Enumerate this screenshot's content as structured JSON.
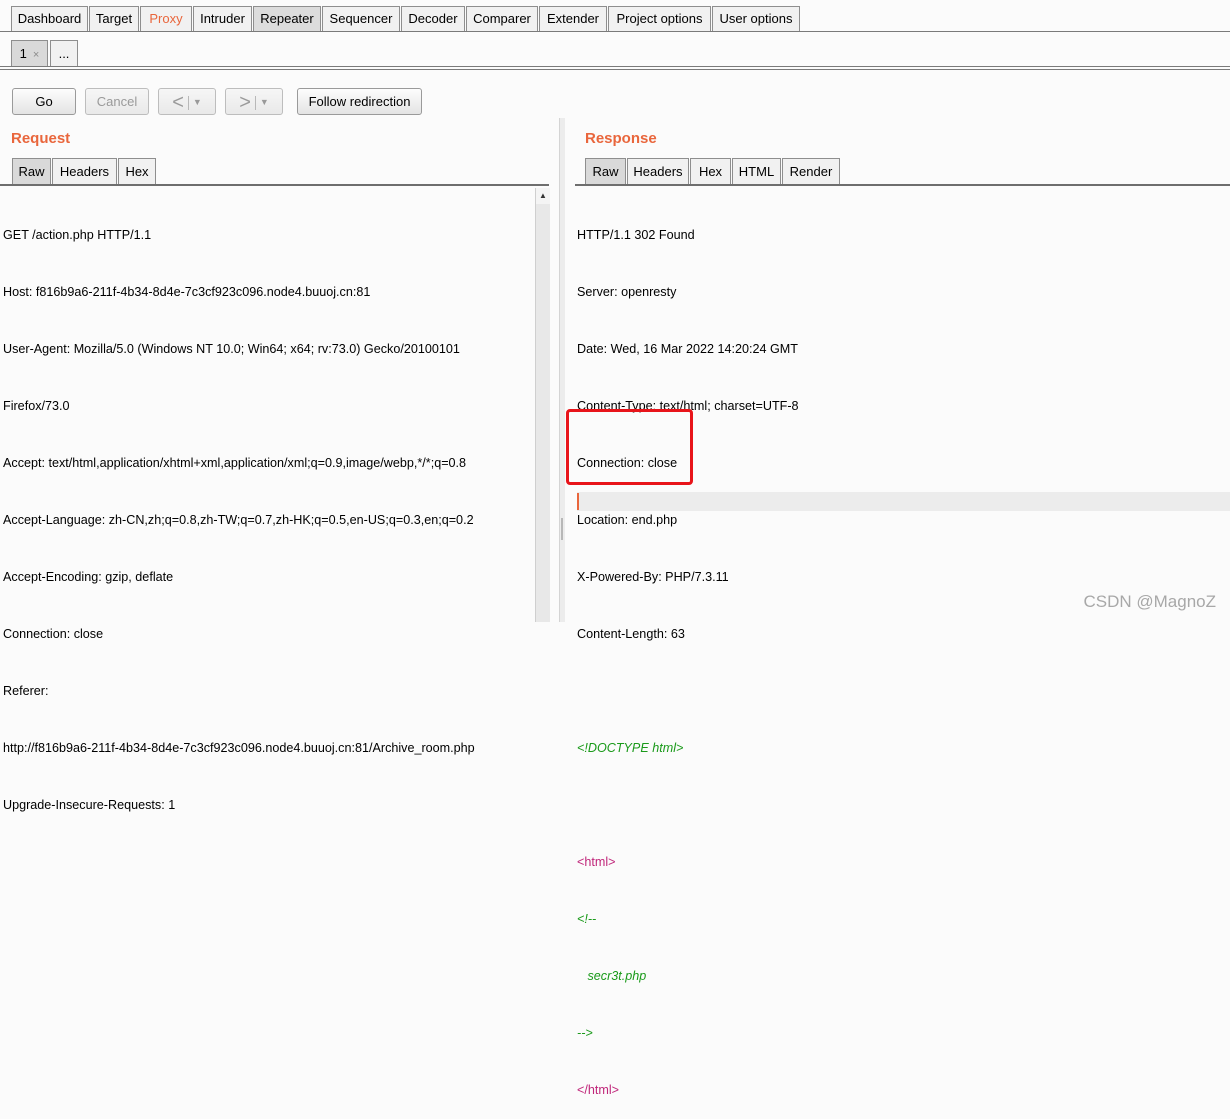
{
  "main_tabs": [
    "Dashboard",
    "Target",
    "Proxy",
    "Intruder",
    "Repeater",
    "Sequencer",
    "Decoder",
    "Comparer",
    "Extender",
    "Project options",
    "User options"
  ],
  "sub_tabs": {
    "first": "1",
    "close": "×",
    "more": "..."
  },
  "buttons": {
    "go": "Go",
    "cancel": "Cancel",
    "back": "<",
    "forward": ">",
    "dropdown": "▼",
    "follow": "Follow redirection"
  },
  "request": {
    "title": "Request",
    "tabs": [
      "Raw",
      "Headers",
      "Hex"
    ],
    "lines": [
      "GET /action.php HTTP/1.1",
      "Host: f816b9a6-211f-4b34-8d4e-7c3cf923c096.node4.buuoj.cn:81",
      "User-Agent: Mozilla/5.0 (Windows NT 10.0; Win64; x64; rv:73.0) Gecko/20100101",
      "Firefox/73.0",
      "Accept: text/html,application/xhtml+xml,application/xml;q=0.9,image/webp,*/*;q=0.8",
      "Accept-Language: zh-CN,zh;q=0.8,zh-TW;q=0.7,zh-HK;q=0.5,en-US;q=0.3,en;q=0.2",
      "Accept-Encoding: gzip, deflate",
      "Connection: close",
      "Referer:",
      "http://f816b9a6-211f-4b34-8d4e-7c3cf923c096.node4.buuoj.cn:81/Archive_room.php",
      "Upgrade-Insecure-Requests: 1"
    ]
  },
  "response": {
    "title": "Response",
    "tabs": [
      "Raw",
      "Headers",
      "Hex",
      "HTML",
      "Render"
    ],
    "headers": [
      "HTTP/1.1 302 Found",
      "Server: openresty",
      "Date: Wed, 16 Mar 2022 14:20:24 GMT",
      "Content-Type: text/html; charset=UTF-8",
      "Connection: close",
      "Location: end.php",
      "X-Powered-By: PHP/7.3.11",
      "Content-Length: 63"
    ],
    "doctype": "<!DOCTYPE html>",
    "html_open": "<html>",
    "comment_open": "<!--",
    "comment_text": "secr3t.php",
    "comment_close": "-->",
    "html_close": "</html>"
  },
  "watermark": "CSDN @MagnoZ"
}
